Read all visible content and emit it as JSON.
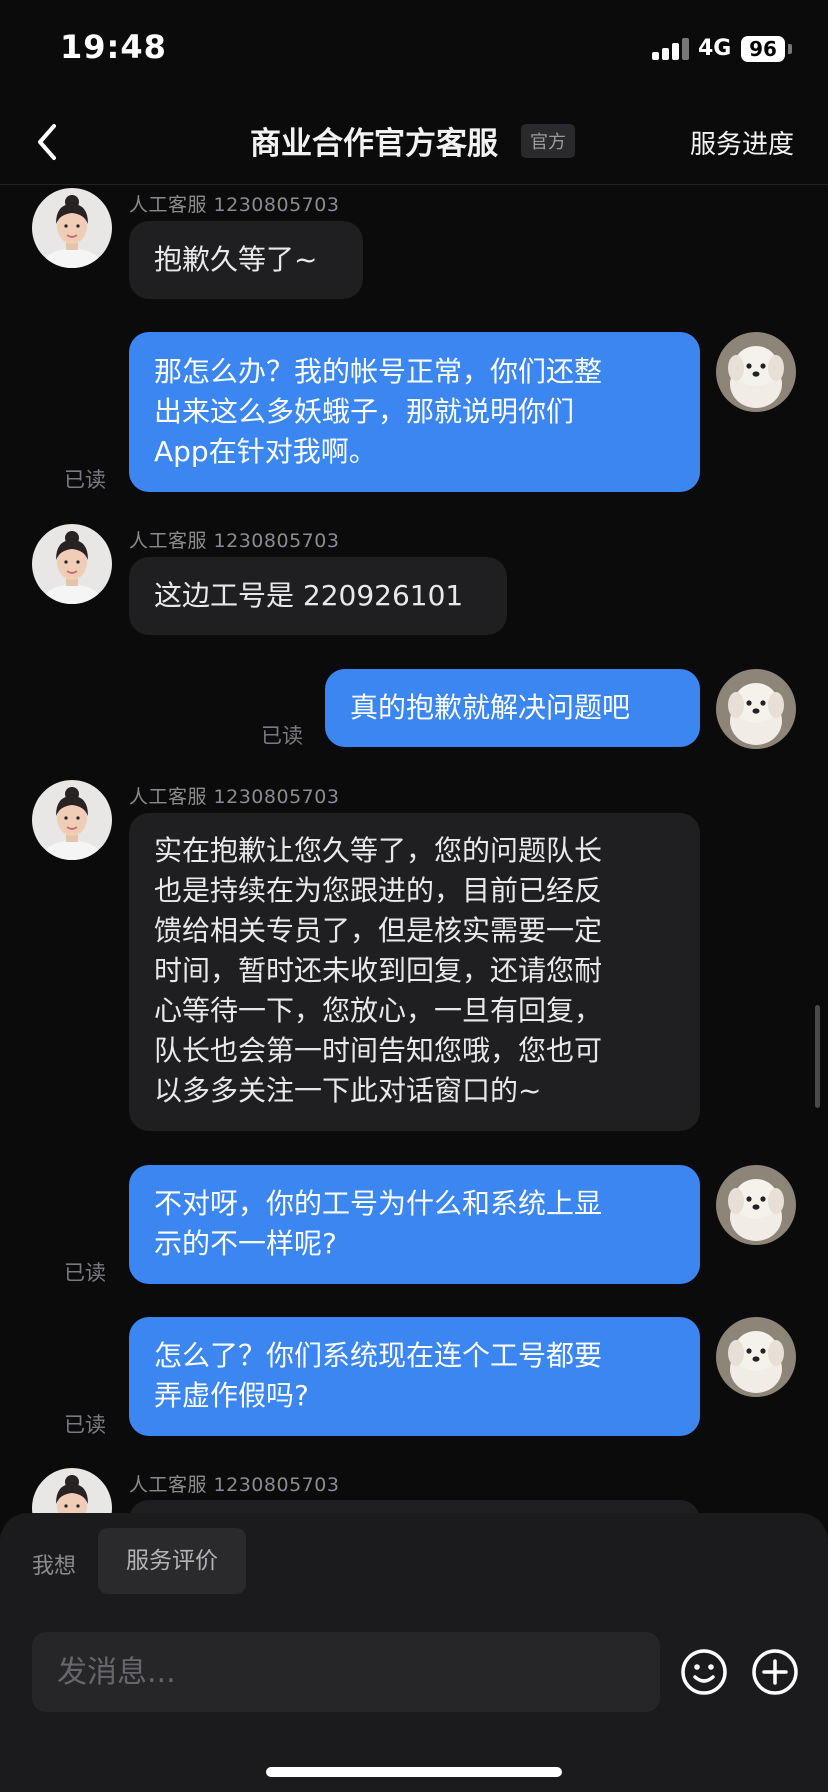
{
  "status_bar": {
    "time": "19:48",
    "network": "4G",
    "battery": "96"
  },
  "header": {
    "title": "商业合作官方客服",
    "badge": "官方",
    "right_action": "服务进度"
  },
  "messages": [
    {
      "sender": "agent",
      "name": "人工客服 1230805703",
      "lines": [
        "抱歉久等了~"
      ]
    },
    {
      "sender": "me",
      "read": "已读",
      "lines": [
        "那怎么办？我的帐号正常，你们还整",
        "出来这么多妖蛾子，那就说明你们",
        "App在针对我啊。"
      ]
    },
    {
      "sender": "agent",
      "name": "人工客服 1230805703",
      "lines": [
        "这边工号是 220926101"
      ]
    },
    {
      "sender": "me",
      "read": "已读",
      "lines": [
        "真的抱歉就解决问题吧"
      ]
    },
    {
      "sender": "agent",
      "name": "人工客服 1230805703",
      "lines": [
        "实在抱歉让您久等了，您的问题队长",
        "也是持续在为您跟进的，目前已经反",
        "馈给相关专员了，但是核实需要一定",
        "时间，暂时还未收到回复，还请您耐",
        "心等待一下，您放心，一旦有回复，",
        "队长也会第一时间告知您哦，您也可",
        "以多多关注一下此对话窗口的~"
      ]
    },
    {
      "sender": "me",
      "read": "已读",
      "lines": [
        "不对呀，你的工号为什么和系统上显",
        "示的不一样呢?"
      ]
    },
    {
      "sender": "me",
      "read": "已读",
      "lines": [
        "怎么了？你们系统现在连个工号都要",
        "弄虚作假吗?"
      ]
    },
    {
      "sender": "agent",
      "name": "人工客服 1230805703",
      "lines": []
    }
  ],
  "bottom_bar": {
    "want_label": "我想",
    "chip": "服务评价",
    "input_placeholder": "发消息..."
  },
  "icons": [
    "back-chevron-icon",
    "signal-icon",
    "battery-icon",
    "emoji-icon",
    "plus-circle-icon"
  ],
  "colors": {
    "background": "#0b0b0c",
    "my_bubble": "#3c86f2",
    "agent_bubble": "#1f1f22",
    "panel": "#1b1b1d"
  }
}
